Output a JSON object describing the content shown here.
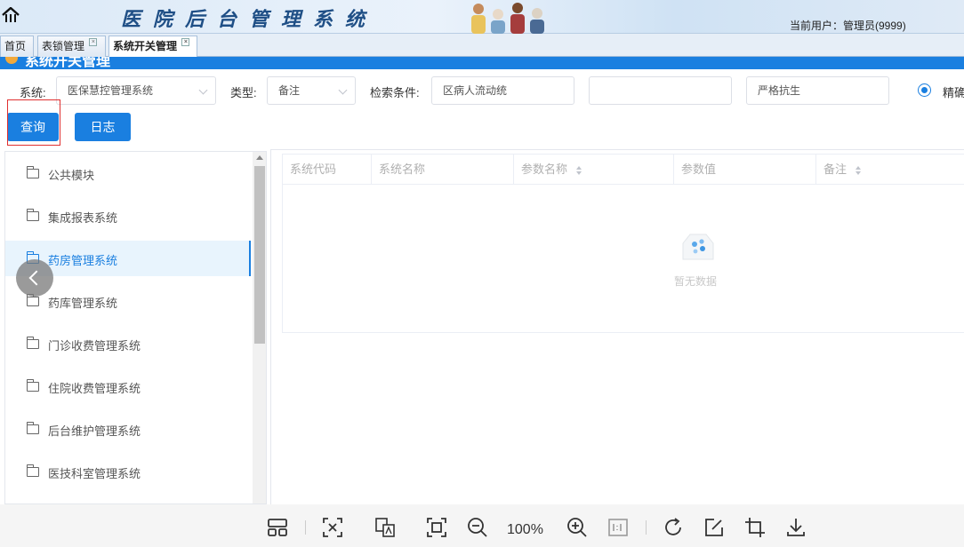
{
  "header": {
    "system_title": "医院后台管理系统",
    "user_label": "当前用户：管理员(9999)"
  },
  "tabs": [
    {
      "label": "首页",
      "closable": false
    },
    {
      "label": "表锁管理",
      "closable": true
    },
    {
      "label": "系统开关管理",
      "closable": true,
      "active": true
    }
  ],
  "page_title": "系统开关管理",
  "filters": {
    "system_label": "系统:",
    "system_value": "医保慧控管理系统",
    "type_label": "类型:",
    "type_value": "备注",
    "search_label": "检索条件:",
    "search1_value": "区病人流动统",
    "search2_value": "",
    "search3_value": "严格抗生",
    "radio_label": "精确"
  },
  "buttons": {
    "query": "查询",
    "log": "日志"
  },
  "tree": {
    "items": [
      {
        "label": "公共模块"
      },
      {
        "label": "集成报表系统"
      },
      {
        "label": "药房管理系统",
        "selected": true
      },
      {
        "label": "药库管理系统"
      },
      {
        "label": "门诊收费管理系统"
      },
      {
        "label": "住院收费管理系统"
      },
      {
        "label": "后台维护管理系统"
      },
      {
        "label": "医技科室管理系统"
      }
    ]
  },
  "table": {
    "columns": [
      {
        "label": "系统代码",
        "sortable": false
      },
      {
        "label": "系统名称",
        "sortable": false
      },
      {
        "label": "参数名称",
        "sortable": true
      },
      {
        "label": "参数值",
        "sortable": false
      },
      {
        "label": "备注",
        "sortable": true
      }
    ],
    "empty_text": "暂无数据"
  },
  "toolbar": {
    "zoom": "100%"
  },
  "colors": {
    "accent": "#1a7fe0",
    "highlight": "#e03030"
  }
}
